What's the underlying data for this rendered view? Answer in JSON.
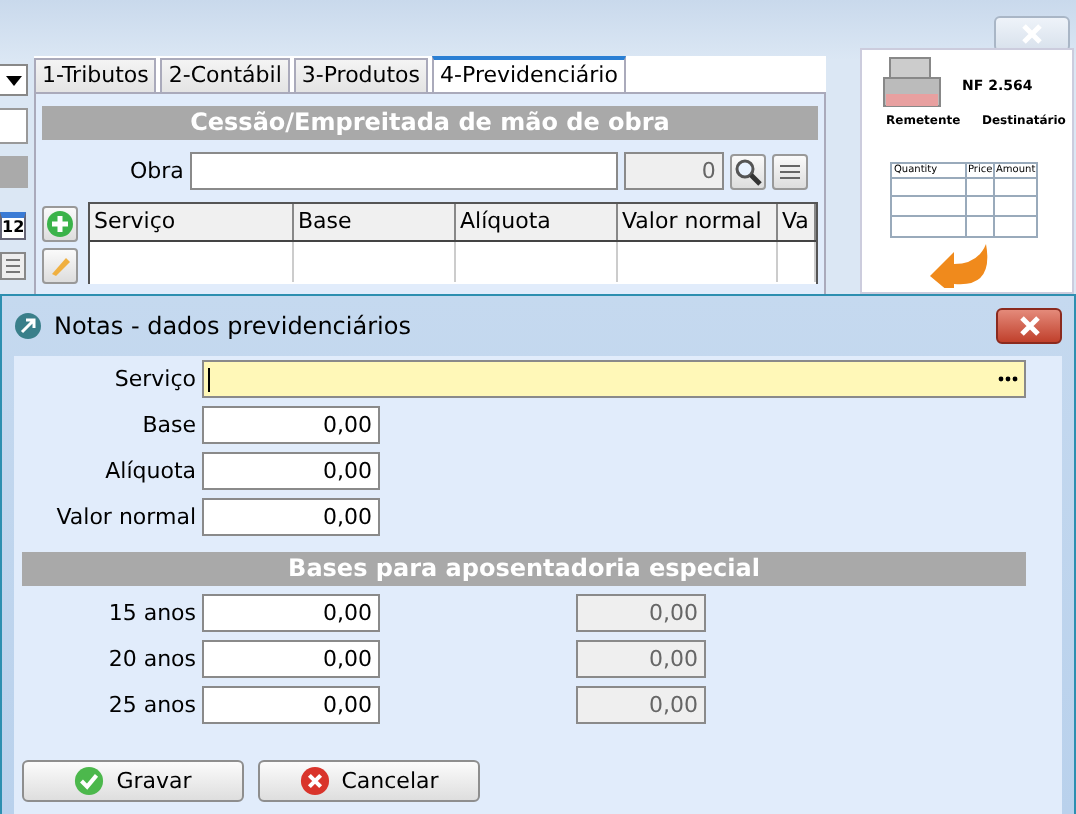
{
  "background_window": {
    "left_strip": {
      "calendar_day": "12"
    },
    "tabs": [
      {
        "label": "1-Tributos",
        "selected": false
      },
      {
        "label": "2-Contábil",
        "selected": false
      },
      {
        "label": "3-Produtos",
        "selected": false
      },
      {
        "label": "4-Previdenciário",
        "selected": true
      }
    ],
    "section_title": "Cessão/Empreitada de mão de obra",
    "obra": {
      "label": "Obra",
      "code": "0"
    },
    "table": {
      "columns": [
        "Serviço",
        "Base",
        "Alíquota",
        "Valor normal",
        "Va"
      ]
    },
    "invoice_image": {
      "number": "NF 2.564",
      "sender": "Remetente",
      "recipient": "Destinatário",
      "columns": [
        "Quantity",
        "Price",
        "Amount"
      ]
    }
  },
  "dialog": {
    "title": "Notas - dados previdenciários",
    "fields": [
      {
        "label": "Serviço",
        "kind": "lookup"
      },
      {
        "label": "Base",
        "kind": "number",
        "value": "0,00"
      },
      {
        "label": "Alíquota",
        "kind": "number",
        "value": "0,00"
      },
      {
        "label": "Valor normal",
        "kind": "number",
        "value": "0,00"
      }
    ],
    "section_title": "Bases para aposentadoria especial",
    "special_rows": [
      {
        "label": "15 anos",
        "value": "0,00",
        "computed": "0,00"
      },
      {
        "label": "20 anos",
        "value": "0,00",
        "computed": "0,00"
      },
      {
        "label": "25 anos",
        "value": "0,00",
        "computed": "0,00"
      }
    ],
    "buttons": [
      {
        "label": "Gravar",
        "kind": "confirm"
      },
      {
        "label": "Cancelar",
        "kind": "cancel"
      }
    ]
  }
}
